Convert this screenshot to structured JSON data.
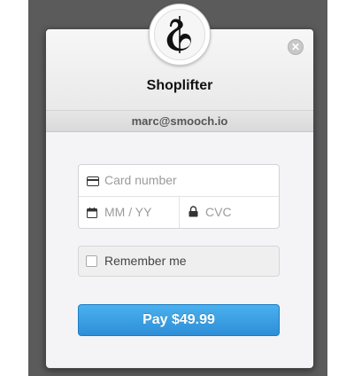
{
  "header": {
    "store_name": "Shoplifter",
    "email": "marc@smooch.io",
    "logo_icon": "store-logo-icon",
    "close_icon": "close-icon"
  },
  "form": {
    "card_number_placeholder": "Card number",
    "expiry_placeholder": "MM / YY",
    "cvc_placeholder": "CVC",
    "remember_label": "Remember me",
    "remember_checked": false
  },
  "pay_button": {
    "label": "Pay $49.99"
  },
  "colors": {
    "backdrop": "#5b5b5b",
    "pay_button": "#3aa0e3",
    "modal_bg": "#f4f4f6"
  }
}
